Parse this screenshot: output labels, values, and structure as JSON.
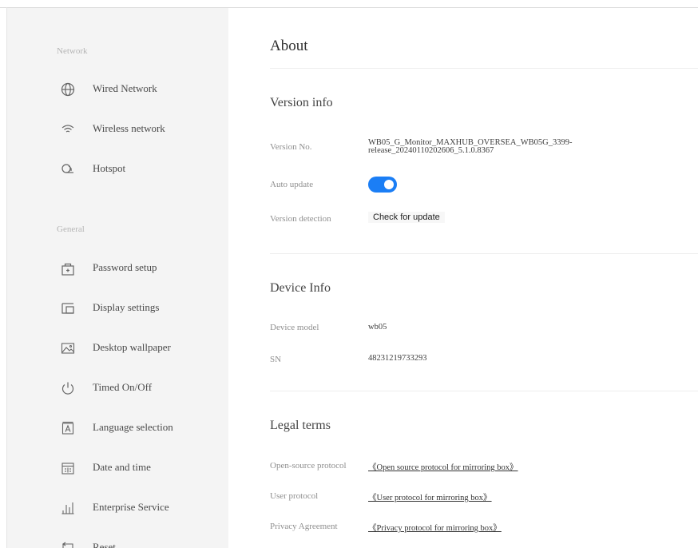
{
  "sidebar": {
    "section_network": "Network",
    "section_general": "General",
    "network_items": [
      {
        "label": "Wired Network",
        "icon": "globe-icon"
      },
      {
        "label": "Wireless network",
        "icon": "wifi-icon"
      },
      {
        "label": "Hotspot",
        "icon": "hotspot-icon"
      }
    ],
    "general_items": [
      {
        "label": "Password setup",
        "icon": "lock-icon"
      },
      {
        "label": "Display settings",
        "icon": "display-icon"
      },
      {
        "label": "Desktop wallpaper",
        "icon": "image-icon"
      },
      {
        "label": "Timed On/Off",
        "icon": "power-icon"
      },
      {
        "label": "Language selection",
        "icon": "language-icon"
      },
      {
        "label": "Date and time",
        "icon": "calendar-icon"
      },
      {
        "label": "Enterprise Service",
        "icon": "bar-chart-icon"
      },
      {
        "label": "Reset",
        "icon": "reset-icon"
      }
    ]
  },
  "main": {
    "title": "About",
    "version_info": {
      "heading": "Version info",
      "version_label": "Version No.",
      "version_line1": "WB05_G_Monitor_MAXHUB_OVERSEA_WB05G_3399-",
      "version_line2": "release_20240110202606_5.1.0.8367",
      "auto_update_label": "Auto update",
      "auto_update_on": true,
      "detection_label": "Version detection",
      "check_button": "Check for update"
    },
    "device_info": {
      "heading": "Device Info",
      "model_label": "Device model",
      "model_value": "wb05",
      "sn_label": "SN",
      "sn_value": "48231219733293"
    },
    "legal": {
      "heading": "Legal terms",
      "items": [
        {
          "label": "Open-source protocol",
          "link": "《Open source protocol for mirroring box》"
        },
        {
          "label": "User protocol",
          "link": "《User protocol for mirroring box》"
        },
        {
          "label": "Privacy Agreement",
          "link": "《Privacy protocol for mirroring box》"
        }
      ]
    }
  },
  "colors": {
    "accent": "#1b7ef5",
    "sidebar_bg": "#f4f4f4"
  }
}
